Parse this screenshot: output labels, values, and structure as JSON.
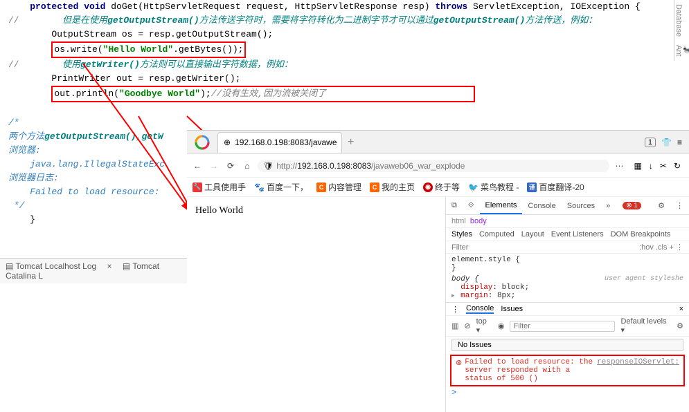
{
  "editor": {
    "l1_kw1": "protected",
    "l1_kw2": "void",
    "l1_mtd": "doGet",
    "l1_p": "(HttpServletRequest request, HttpServletResponse resp) ",
    "l1_kw3": "throws",
    "l1_ex": " ServletException, IOException {",
    "l2_mark": "//",
    "l2_c1": "        但是在使用",
    "l2_c2": "getOutputStream()",
    "l2_c3": "方法传送字符时，需要将字符转化为二进制字节才可以通过",
    "l2_c4": "getOutputStream()",
    "l2_c5": "方法传送，例如：",
    "l3": "        OutputStream os = resp.getOutputStream();",
    "l4a": "os.write(",
    "l4b": "\"Hello World\"",
    "l4c": ".getBytes());",
    "l5_mark": "//",
    "l5_c1": "        使用",
    "l5_c2": "getWriter()",
    "l5_c3": "方法则可以直接输出字符数据，例如：",
    "l6": "        PrintWriter out = resp.getWriter();",
    "l7a": "out.println(",
    "l7b": "\"Goodbye World\"",
    "l7c": ");",
    "l7d": "//没有生效,因为流被关闭了",
    "d1": "/*",
    "d2a": "两个方法",
    "d2b": "getOutputStream()",
    "d2c": ",",
    "d2d": "getW",
    "d3": "浏览器:",
    "d4": "    java.lang.IllegalStateExc",
    "d5": "浏览器日志:",
    "d6": "    Failed to load resource:",
    "d7": " */",
    "l8": "    }"
  },
  "tabs": {
    "t1": "Tomcat Localhost Log",
    "t2": "Tomcat Catalina L"
  },
  "side": {
    "db": "Database",
    "ant": "Ant"
  },
  "browser": {
    "tab_title": "192.168.0.198:8083/javawe",
    "count": "1",
    "url_proto": "http://",
    "url_host": "192.168.0.198:8083",
    "url_path": "/javaweb06_war_explode",
    "bm1": "工具使用手",
    "bm2": "百度一下，",
    "bm3": "内容管理",
    "bm4": "我的主页",
    "bm5": "终于等",
    "bm6": "菜鸟教程 -",
    "bm7": "百度翻译-20",
    "content": "Hello World"
  },
  "dev": {
    "tab_el": "Elements",
    "tab_co": "Console",
    "tab_so": "Sources",
    "more": "»",
    "err_n": "1",
    "crumb_h": "html",
    "crumb_b": "body",
    "st_styles": "Styles",
    "st_comp": "Computed",
    "st_lay": "Layout",
    "st_ev": "Event Listeners",
    "st_dom": "DOM Breakpoints",
    "filter_ph": "Filter",
    "hov": ":hov",
    "cls": ".cls",
    "plus": "+",
    "es": "element.style {",
    "cb": "}",
    "body_sel": "body {",
    "ua": "user agent styleshe",
    "p1": "display",
    "v1": "block",
    "p2": "margin",
    "v2": "8px",
    "ct_con": "Console",
    "ct_iss": "Issues",
    "top": "top ▾",
    "eye": "◉",
    "lvl": "Default levels ▾",
    "filter2_ph": "Filter",
    "noiss": "No Issues",
    "err_icon": "⊗",
    "err_msg": "Failed to load resource: the server responded with a status of 500 ()",
    "err_src": "responseIOServlet:",
    "prompt": ">"
  }
}
